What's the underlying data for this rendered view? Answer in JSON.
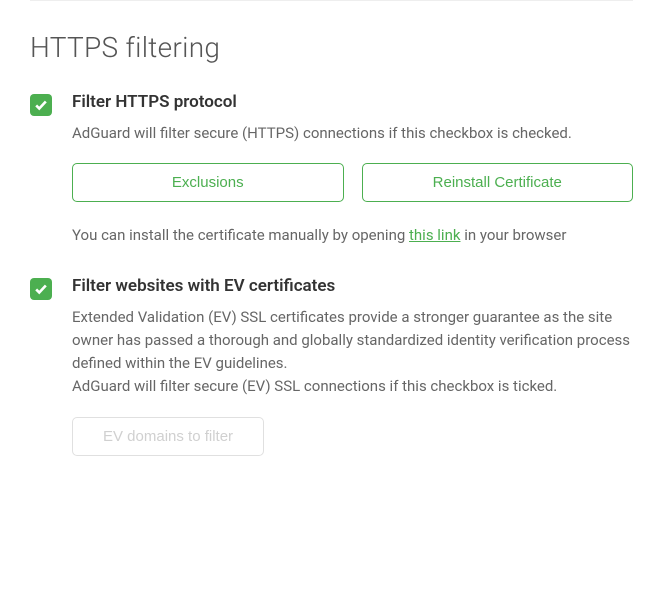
{
  "section_title": "HTTPS filtering",
  "filter_https": {
    "title": "Filter HTTPS protocol",
    "description": "AdGuard will filter secure (HTTPS) connections if this checkbox is checked.",
    "checked": true,
    "btn_exclusions": "Exclusions",
    "btn_reinstall": "Reinstall Certificate",
    "note_prefix": "You can install the certificate manually by opening ",
    "note_link": "this link",
    "note_suffix": " in your browser"
  },
  "filter_ev": {
    "title": "Filter websites with EV certificates",
    "description_1": "Extended Validation (EV) SSL certificates provide a stronger guarantee as the site owner has passed a thorough and globally standardized identity verification process defined within the EV guidelines.",
    "description_2": "AdGuard will filter secure (EV) SSL connections if this checkbox is ticked.",
    "checked": true,
    "btn_ev_domains": "EV domains to filter"
  }
}
